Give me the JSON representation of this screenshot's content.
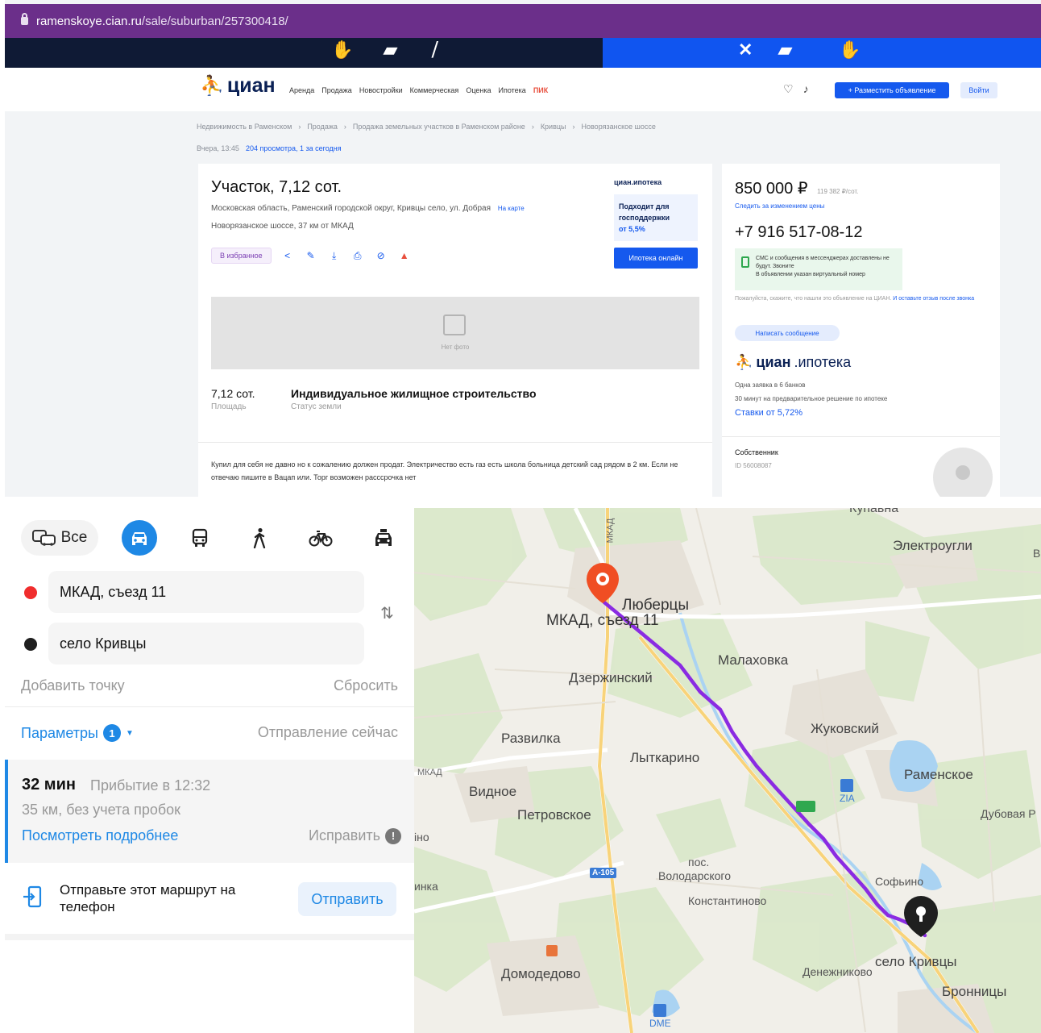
{
  "browser": {
    "url_host": "ramenskoye.cian.ru",
    "url_path": "/sale/suburban/257300418/"
  },
  "cian": {
    "logo": "циан",
    "nav": [
      "Аренда",
      "Продажа",
      "Новостройки",
      "Коммерческая",
      "Оценка",
      "Ипотека",
      "ПИК"
    ],
    "place_ad": "+ Разместить объявление",
    "login": "Войти",
    "breadcrumbs": [
      "Недвижимость в Раменском",
      "Продажа",
      "Продажа земельных участков в Раменском районе",
      "Кривцы",
      "Новорязанское шоссе"
    ],
    "published": "Вчера, 13:45",
    "views": "204 просмотра, 1 за сегодня",
    "title": "Участок, 7,12 сот.",
    "address": "Московская область, Раменский городской округ, Кривцы село, ул. Добрая",
    "address_map": "На карте",
    "highway": "Новорязанское шоссе, 37 км от МКАД",
    "fav_label": "В избранное",
    "mortgage_brand": "циан.ипотека",
    "mortgage_offer": "Подходит для господдержки",
    "mortgage_rate": "от 5,5%",
    "mortgage_btn": "Ипотека онлайн",
    "photo_caption": "Нет фото",
    "area_value": "7,12 сот.",
    "area_label": "Площадь",
    "status_value": "Индивидуальное жилищное строительство",
    "status_label": "Статус земли",
    "description": "Купил для себя не давно но к сожалению должен продат. Электричество есть газ есть школа больница детский сад рядом в 2 км. Если не отвечаю пишите в Вацап или. Торг возможен расссрочка нет",
    "price": "850 000 ₽",
    "price_per": "119 382 ₽/сот.",
    "follow_price": "Следить за изменением цены",
    "phone": "+7 916 517-08-12",
    "sms_text": "СМС и сообщения в мессенджерах доставлены не будут. Звоните",
    "sms_sub": "В объявлении указан виртуальный номер",
    "sms_note": "Пожалуйста, скажите, что нашли это объявление на ЦИАН.",
    "sms_note_link": "И оставьте отзыв после звонка",
    "write_btn": "Написать сообщение",
    "ipoteka_logo_a": "циан",
    "ipoteka_logo_b": ".ипотека",
    "ipoteka_line1": "Одна заявка в 6 банков",
    "ipoteka_line2": "30 минут на предварительное решение по ипотеке",
    "ipoteka_rate": "Ставки от 5,72%",
    "owner_label": "Собственник",
    "owner_id": "ID 56008087"
  },
  "route": {
    "mode_all": "Все",
    "from": "МКАД, съезд 11",
    "to": "село Кривцы",
    "add_point": "Добавить точку",
    "reset": "Сбросить",
    "params": "Параметры",
    "params_count": "1",
    "departure": "Отправление сейчас",
    "duration": "32 мин",
    "arrival": "Прибытие в 12:32",
    "distance": "35 км, без учета пробок",
    "details": "Посмотреть подробнее",
    "fix": "Исправить",
    "send_text": "Отправьте этот маршрут на телефон",
    "send_btn": "Отправить"
  },
  "map": {
    "labels": {
      "kupavna": "Купавна",
      "elektrougli": "Электроугли",
      "lyubertsy": "Люберцы",
      "mkad_exit": "МКАД, съезд 11",
      "malakhovka": "Малаховка",
      "dzerzhinsky": "Дзержинский",
      "zhukovsky": "Жуковский",
      "razvilka": "Развилка",
      "lytkarino": "Лыткарино",
      "ramenskoe": "Раменское",
      "vidnoe": "Видное",
      "petrovskoe": "Петровское",
      "dubovaya": "Дубовая Р",
      "sofyino": "Софьино",
      "volodarskogo_1": "пос.",
      "volodarskogo_2": "Володарского",
      "konstantinovo": "Константиново",
      "krivtsy": "село Кривцы",
      "denezhnikovo": "Денежниково",
      "domodedovo": "Домодедово",
      "bronnitsy": "Бронницы",
      "mkad_left": "МКАД",
      "mkad_top": "МКАД",
      "zia": "ZIA",
      "dme": "DME",
      "a105": "А-105",
      "left_no": "іно",
      "left_nka": "инка",
      "right_b": "В"
    },
    "colors": {
      "route": "#8a2be2",
      "start_pin": "#f04e23",
      "end_pin": "#1f1f1f"
    }
  }
}
